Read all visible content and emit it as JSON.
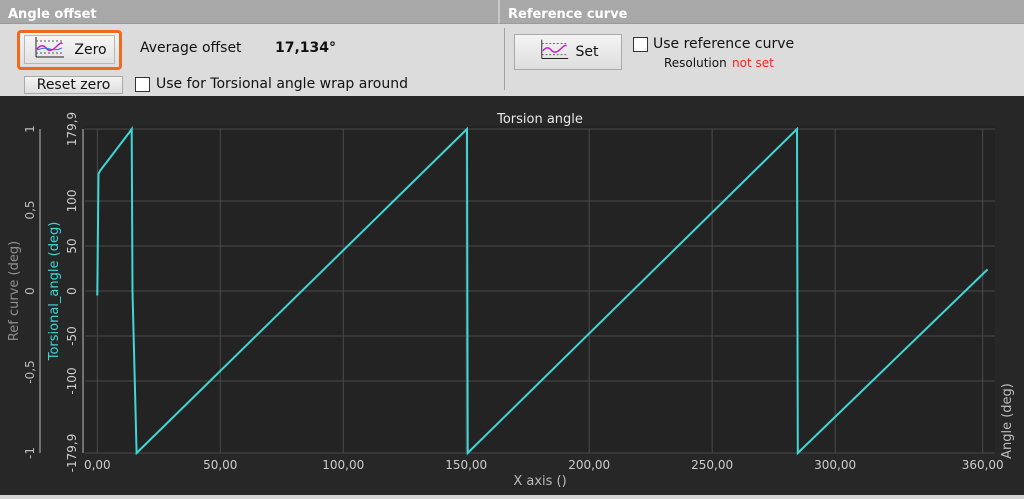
{
  "angle_offset": {
    "header": "Angle offset",
    "zero_button": "Zero",
    "average_label": "Average offset",
    "average_value": "17,134°",
    "reset_button": "Reset zero",
    "wrap_checkbox_label": "Use for Torsional angle wrap around",
    "wrap_checked": false
  },
  "reference_curve": {
    "header": "Reference curve",
    "set_button": "Set",
    "use_checkbox_label": "Use reference curve",
    "use_checked": false,
    "resolution_label": "Resolution",
    "resolution_value": "not set",
    "resolution_color": "#ff2020"
  },
  "chart_data": {
    "type": "line",
    "title": "Torsion angle",
    "xlabel": "X axis ()",
    "ylabel_left_outer": "Ref curve (deg)",
    "ylabel_left_inner": "Torsional_angle (deg)",
    "ylabel_right": "Angle (deg)",
    "xlim": [
      -5,
      365
    ],
    "ylim": [
      -179.9,
      179.9
    ],
    "ref_ylim": [
      -1,
      1
    ],
    "x_ticks": [
      "0,00",
      "50,00",
      "100,00",
      "150,00",
      "200,00",
      "250,00",
      "300,00",
      "360,00"
    ],
    "y_ticks": [
      "179,9",
      "100",
      "50",
      "0",
      "-50",
      "-100",
      "-179,9"
    ],
    "ref_y_ticks": [
      "1",
      "0,5",
      "0",
      "-0,5",
      "-1"
    ],
    "grid": true,
    "series": [
      {
        "name": "Torsional_angle",
        "color": "#3fd6d6",
        "x": [
          0,
          0.5,
          1,
          13,
          14,
          14.3,
          16,
          150.3,
          150.6,
          284.5,
          284.8,
          362
        ],
        "y": [
          -5,
          130,
          133,
          176,
          179.9,
          0,
          -179.9,
          179.9,
          -179.9,
          179.9,
          -179.9,
          24
        ]
      }
    ]
  }
}
